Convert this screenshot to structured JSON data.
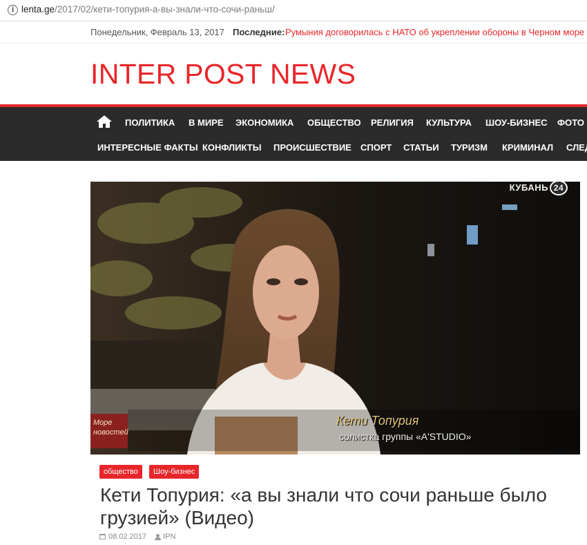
{
  "browser": {
    "url_host": "lenta.ge",
    "url_path": "/2017/02/кети-топурия-а-вы-знали-что-сочи-раньш/"
  },
  "topbar": {
    "date": "Понедельник, Февраль 13, 2017",
    "latest_label": "Последние:",
    "latest_text": "Румыния договорилась с НАТО об укреплении обороны в Черном море"
  },
  "site": {
    "logo": "INTER POST NEWS",
    "accent_color": "#e8262a",
    "nav_bg": "#2b2b2b"
  },
  "nav": {
    "home_icon": "home-icon",
    "row1": [
      "ПОЛИТИКА",
      "В МИРЕ",
      "ЭКОНОМИКА",
      "ОБЩЕСТВО",
      "РЕЛИГИЯ",
      "КУЛЬТУРА",
      "ШОУ-БИЗНЕС",
      "ФОТО"
    ],
    "row2": [
      "ИНТЕРЕСНЫЕ ФАКТЫ",
      "КОНФЛИКТЫ",
      "ПРОИСШЕСТВИЕ",
      "СПОРТ",
      "СТАТЬИ",
      "ТУРИЗМ",
      "КРИМИНАЛ",
      "СЛЕД"
    ]
  },
  "article": {
    "image": {
      "channel": "КУБАНЬ",
      "channel_num": "24",
      "caption_name": "Кети Топурия",
      "caption_role": "солистка группы «A'STUDIO»",
      "side_logo": "Море новостей"
    },
    "tags": [
      "общество",
      "Шоу-бизнес"
    ],
    "title": "Кети Топурия: «а вы знали что сочи раньше было грузией» (Видео)",
    "date": "08.02.2017",
    "author": "IPN"
  }
}
